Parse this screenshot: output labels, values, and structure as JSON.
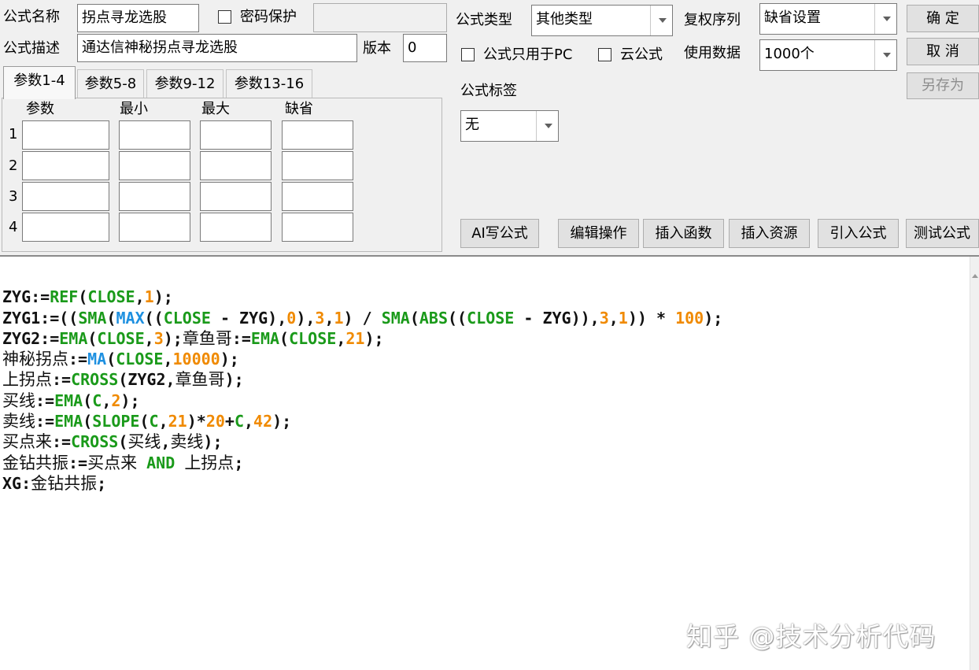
{
  "formula": {
    "name_label": "公式名称",
    "name_value": "拐点寻龙选股",
    "password_label": "密码保护",
    "desc_label": "公式描述",
    "desc_value": "通达信神秘拐点寻龙选股",
    "version_label": "版本",
    "version_value": "0",
    "type_label": "公式类型",
    "type_value": "其他类型",
    "rights_label": "复权序列",
    "rights_value": "缺省设置",
    "pc_only_label": "公式只用于PC",
    "cloud_label": "云公式",
    "data_label": "使用数据",
    "data_value": "1000个",
    "tag_label": "公式标签",
    "tag_value": "无"
  },
  "buttons": {
    "ok": "确  定",
    "cancel": "取  消",
    "save_as": "另存为",
    "ai_write": "AI写公式",
    "edit_ops": "编辑操作",
    "insert_func": "插入函数",
    "insert_res": "插入资源",
    "import_formula": "引入公式",
    "test_formula": "测试公式"
  },
  "param_tabs": [
    "参数1-4",
    "参数5-8",
    "参数9-12",
    "参数13-16"
  ],
  "param_headers": [
    "参数",
    "最小",
    "最大",
    "缺省"
  ],
  "param_rows": [
    "1",
    "2",
    "3",
    "4"
  ],
  "watermark": "知乎 @技术分析代码",
  "code_lines": [
    "ZYG:=REF(CLOSE,1);",
    "ZYG1:=((SMA(MAX((CLOSE - ZYG),0),3,1) / SMA(ABS((CLOSE - ZYG)),3,1)) * 100);",
    "ZYG2:=EMA(CLOSE,3);章鱼哥:=EMA(CLOSE,21);",
    "神秘拐点:=MA(CLOSE,10000);",
    "上拐点:=CROSS(ZYG2,章鱼哥);",
    "买线:=EMA(C,2);",
    "卖线:=EMA(SLOPE(C,21)*20+C,42);",
    "买点来:=CROSS(买线,卖线);",
    "金钻共振:=买点来 AND 上拐点;",
    "XG:金钻共振;"
  ],
  "colors": {
    "keyword_green": "#1a9a1a",
    "keyword_blue": "#1e90e0",
    "number_orange": "#f08a00",
    "window_bg": "#f0f0f0"
  }
}
